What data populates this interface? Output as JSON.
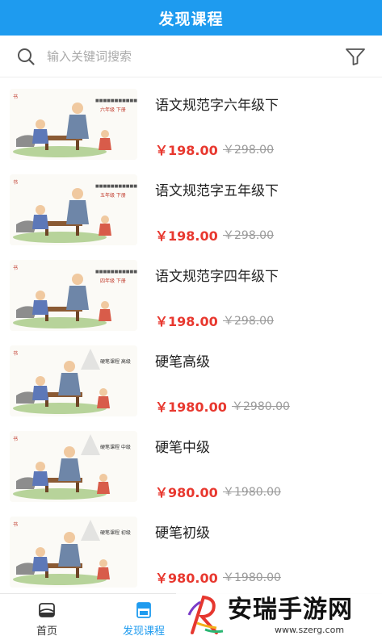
{
  "header": {
    "title": "发现课程"
  },
  "search": {
    "placeholder": "输入关键词搜索"
  },
  "courses": [
    {
      "title": "语文规范字六年级下",
      "price": "￥198.00",
      "original_price": "￥298.00",
      "thumb_tag": "六年级  下册"
    },
    {
      "title": "语文规范字五年级下",
      "price": "￥198.00",
      "original_price": "￥298.00",
      "thumb_tag": "五年级  下册"
    },
    {
      "title": "语文规范字四年级下",
      "price": "￥198.00",
      "original_price": "￥298.00",
      "thumb_tag": "四年级  下册"
    },
    {
      "title": "硬笔高级",
      "price": "￥1980.00",
      "original_price": "￥2980.00",
      "thumb_tag": "硬笔课程 高级"
    },
    {
      "title": "硬笔中级",
      "price": "￥980.00",
      "original_price": "￥1980.00",
      "thumb_tag": "硬笔课程 中级"
    },
    {
      "title": "硬笔初级",
      "price": "￥980.00",
      "original_price": "￥1980.00",
      "thumb_tag": "硬笔课程 初级"
    }
  ],
  "tabbar": {
    "home_label": "首页",
    "discover_label": "发现课程"
  },
  "watermark": {
    "text": "安瑞手游网",
    "url": "www.szerg.com"
  },
  "colors": {
    "primary": "#1e9bef",
    "price": "#e8382f",
    "strike": "#9a9a9a"
  }
}
